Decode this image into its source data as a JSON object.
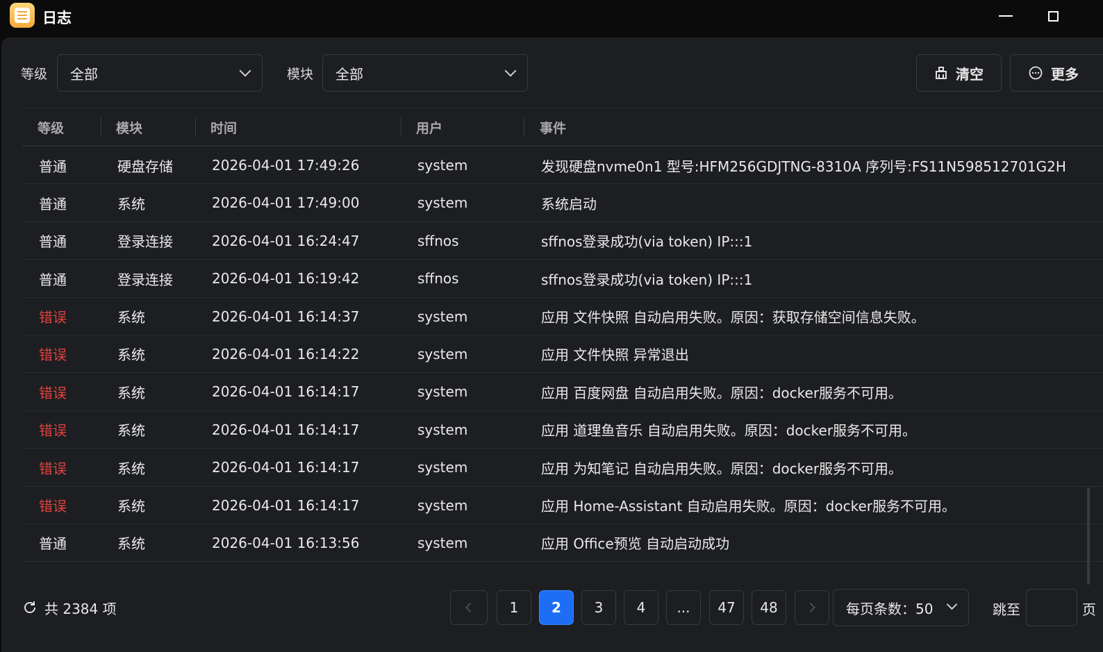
{
  "window": {
    "title": "日志",
    "icon": "log-app-icon"
  },
  "filters": {
    "level_label": "等级",
    "level_value": "全部",
    "module_label": "模块",
    "module_value": "全部",
    "clear_label": "清空",
    "more_label": "更多"
  },
  "table": {
    "headers": {
      "level": "等级",
      "module": "模块",
      "time": "时间",
      "user": "用户",
      "event": "事件"
    },
    "rows": [
      {
        "level": "普通",
        "module": "硬盘存储",
        "time": "2026-04-01 17:49:26",
        "user": "system",
        "event": "发现硬盘nvme0n1 型号:HFM256GDJTNG-8310A 序列号:FS11N598512701G2H"
      },
      {
        "level": "普通",
        "module": "系统",
        "time": "2026-04-01 17:49:00",
        "user": "system",
        "event": "系统启动"
      },
      {
        "level": "普通",
        "module": "登录连接",
        "time": "2026-04-01 16:24:47",
        "user": "sffnos",
        "event": "sffnos登录成功(via token) IP:::1"
      },
      {
        "level": "普通",
        "module": "登录连接",
        "time": "2026-04-01 16:19:42",
        "user": "sffnos",
        "event": "sffnos登录成功(via token) IP:::1"
      },
      {
        "level": "错误",
        "module": "系统",
        "time": "2026-04-01 16:14:37",
        "user": "system",
        "event": "应用 文件快照 自动启用失败。原因：获取存储空间信息失败。"
      },
      {
        "level": "错误",
        "module": "系统",
        "time": "2026-04-01 16:14:22",
        "user": "system",
        "event": "应用 文件快照 异常退出"
      },
      {
        "level": "错误",
        "module": "系统",
        "time": "2026-04-01 16:14:17",
        "user": "system",
        "event": "应用 百度网盘 自动启用失败。原因：docker服务不可用。"
      },
      {
        "level": "错误",
        "module": "系统",
        "time": "2026-04-01 16:14:17",
        "user": "system",
        "event": "应用 道理鱼音乐 自动启用失败。原因：docker服务不可用。"
      },
      {
        "level": "错误",
        "module": "系统",
        "time": "2026-04-01 16:14:17",
        "user": "system",
        "event": "应用 为知笔记 自动启用失败。原因：docker服务不可用。"
      },
      {
        "level": "错误",
        "module": "系统",
        "time": "2026-04-01 16:14:17",
        "user": "system",
        "event": "应用 Home-Assistant 自动启用失败。原因：docker服务不可用。"
      },
      {
        "level": "普通",
        "module": "系统",
        "time": "2026-04-01 16:13:56",
        "user": "system",
        "event": "应用 Office预览 自动启动成功"
      }
    ]
  },
  "footer": {
    "total_text": "共 2384 项",
    "pages": [
      "1",
      "2",
      "3",
      "4",
      "...",
      "47",
      "48"
    ],
    "current_page": "2",
    "page_size_text": "每页条数：50",
    "jump_label": "跳至",
    "jump_value": "",
    "jump_suffix": "页"
  },
  "colors": {
    "background": "#1d1e21",
    "accent": "#1e6ef5",
    "error": "#e3413f"
  }
}
